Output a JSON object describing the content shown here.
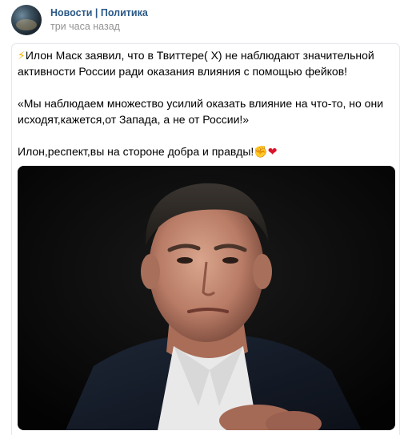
{
  "post": {
    "author": "Новости | Политика",
    "time": "три часа назад",
    "line1_icon": "⚡",
    "line1": "Илон Маск заявил, что в Твиттере( X) не наблюдают значительной активности России ради оказания влияния с помощью фейков!",
    "line2": "«Мы наблюдаем множество усилий оказать влияние на что-то, но они исходят,кажется,от Запада, а не от России!»",
    "line3": "Илон,респект,вы на стороне добра и правды!",
    "line3_fist": "✊",
    "line3_heart": "❤",
    "photo_icon": "portrait-photo"
  },
  "colors": {
    "author": "#2a5885",
    "time": "#939393",
    "border": "#e5e7ea",
    "photo_bg": "#050505"
  }
}
